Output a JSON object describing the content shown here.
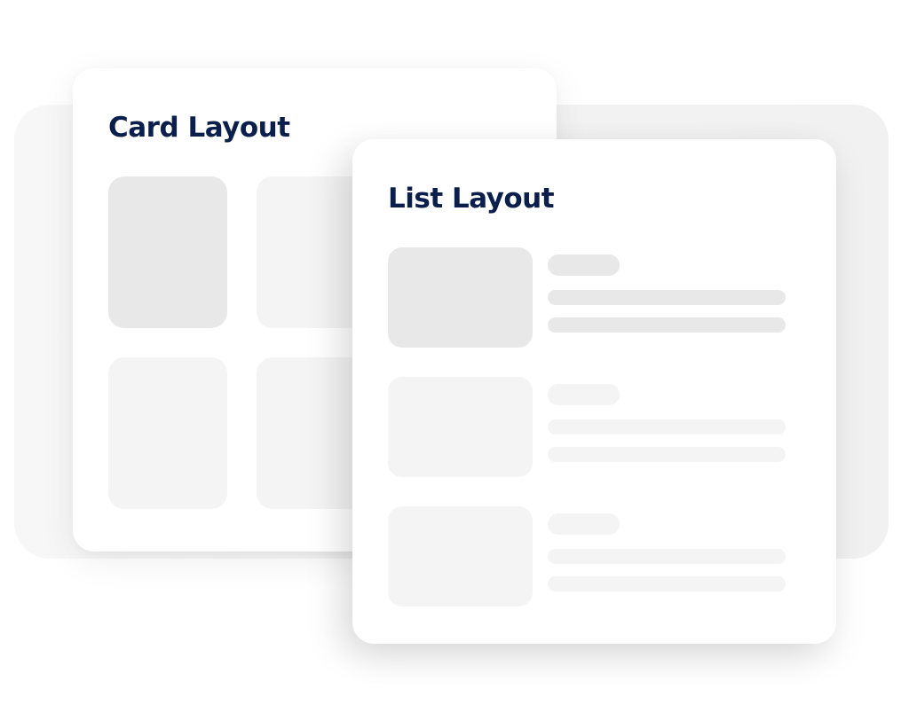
{
  "colors": {
    "title": "#0b1f4d",
    "placeholder_dark": "#e8e8e8",
    "placeholder_light": "#f4f4f4",
    "card_background": "#ffffff",
    "backdrop": "#f3f3f3"
  },
  "card_layout": {
    "title": "Card Layout",
    "tiles": [
      {
        "shade": "dark"
      },
      {
        "shade": "light"
      },
      {
        "shade": "light"
      },
      {
        "shade": "light"
      }
    ]
  },
  "list_layout": {
    "title": "List Layout",
    "items": [
      {
        "shade": "dark",
        "text_lines": 2,
        "has_tag_pill": true
      },
      {
        "shade": "light",
        "text_lines": 2,
        "has_tag_pill": true
      },
      {
        "shade": "light",
        "text_lines": 2,
        "has_tag_pill": true
      }
    ]
  }
}
